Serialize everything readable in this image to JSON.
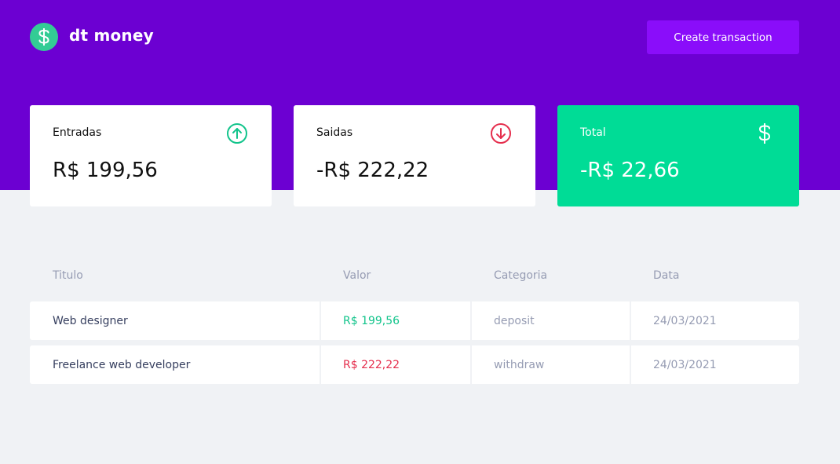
{
  "app": {
    "name": "dt money",
    "create_button_label": "Create transaction"
  },
  "colors": {
    "header_bg": "#6c00d2",
    "button_bg": "#8a0dfa",
    "green": "#33cc95",
    "total_bg": "#00dc96",
    "red": "#e52e4d",
    "page_bg": "#f0f2f5"
  },
  "summary": {
    "income": {
      "label": "Entradas",
      "value": "R$ 199,56",
      "icon": "arrow-up-circle-icon"
    },
    "outcome": {
      "label": "Saidas",
      "value": "-R$ 222,22",
      "icon": "arrow-down-circle-icon"
    },
    "total": {
      "label": "Total",
      "value": "-R$ 22,66",
      "icon": "dollar-icon"
    }
  },
  "table": {
    "columns": [
      "Titulo",
      "Valor",
      "Categoria",
      "Data"
    ],
    "rows": [
      {
        "title": "Web designer",
        "value": "R$ 199,56",
        "category": "deposit",
        "date": "24/03/2021",
        "type": "deposit"
      },
      {
        "title": "Freelance web developer",
        "value": "R$ 222,22",
        "category": "withdraw",
        "date": "24/03/2021",
        "type": "withdraw"
      }
    ]
  }
}
